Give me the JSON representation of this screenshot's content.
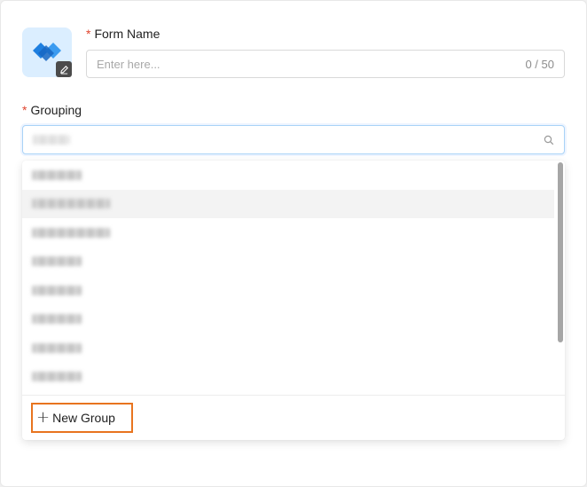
{
  "form": {
    "name_label": "Form Name",
    "required_mark": "*",
    "name_placeholder": "Enter here...",
    "name_value": "",
    "name_counter": "0 / 50",
    "icon": "handshake-icon",
    "edit_icon": "pencil-icon"
  },
  "grouping": {
    "label": "Grouping",
    "required_mark": "*",
    "search_icon": "search-icon",
    "options_count_visible": 8,
    "hovered_option_index": 1,
    "new_group_label": "New Group",
    "new_group_icon": "plus-icon"
  },
  "colors": {
    "accent_blue": "#1677ff",
    "required_red": "#e0452f",
    "highlight_orange": "#e8741f"
  }
}
